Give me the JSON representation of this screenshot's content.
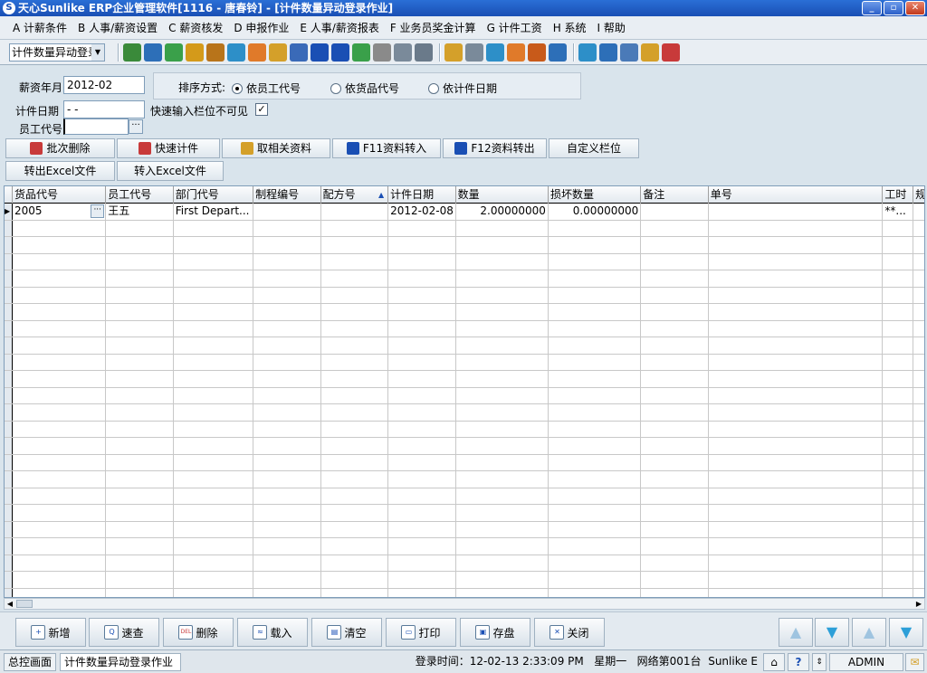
{
  "window": {
    "title": "天心Sunlike ERP企业管理软件[1116 - 唐春铃] - [计件数量异动登录作业]",
    "buttons": [
      "_",
      "▫",
      "✕"
    ]
  },
  "menu": [
    "A 计薪条件",
    "B 人事/薪资设置",
    "C 薪资核发",
    "D 申报作业",
    "E 人事/薪资报表",
    "F 业务员奖金计算",
    "G 计件工资",
    "H 系统",
    "I 帮助"
  ],
  "toolbar": {
    "select_value": "计件数量异动登录",
    "icons": [
      {
        "name": "tree-icon",
        "color": "#3a8a3a"
      },
      {
        "name": "monitor-icon",
        "color": "#2d6fb8"
      },
      {
        "name": "phone-icon",
        "color": "#3aa04a"
      },
      {
        "name": "coins-icon",
        "color": "#d49a1a"
      },
      {
        "name": "briefcase-icon",
        "color": "#b8741a"
      },
      {
        "name": "home-icon",
        "color": "#2d8fc8"
      },
      {
        "name": "people-icon",
        "color": "#e07a2a"
      },
      {
        "name": "mail-icon",
        "color": "#d4a02a"
      },
      {
        "name": "book-icon",
        "color": "#3a6ab8"
      },
      {
        "name": "key-icon",
        "color": "#1a4fb4"
      },
      {
        "name": "help-icon",
        "color": "#1a4fb4"
      },
      {
        "name": "dollar-icon",
        "color": "#3aa04a"
      },
      {
        "name": "cart-icon",
        "color": "#8a8a8a"
      },
      {
        "name": "document-icon",
        "color": "#7a8a9a"
      },
      {
        "name": "calculator-icon",
        "color": "#6a7a8a"
      },
      {
        "name": "folder-icon",
        "color": "#d4a02a"
      },
      {
        "name": "copy-icon",
        "color": "#7a8a9a"
      },
      {
        "name": "check-icon",
        "color": "#2d8fc8"
      },
      {
        "name": "bell-icon",
        "color": "#e07a2a"
      },
      {
        "name": "network-icon",
        "color": "#c85a1a"
      },
      {
        "name": "screen-icon",
        "color": "#2d6fb8"
      },
      {
        "name": "refresh-icon",
        "color": "#2d8fc8"
      },
      {
        "name": "window-icon",
        "color": "#2d6fb8"
      },
      {
        "name": "close-window-icon",
        "color": "#4a7ab8"
      },
      {
        "name": "tile-windows-icon",
        "color": "#d4a02a"
      },
      {
        "name": "exit-icon",
        "color": "#c83a3a"
      }
    ]
  },
  "form": {
    "salary_month_label": "薪资年月",
    "salary_month_value": "2012-02",
    "sort_label": "排序方式:",
    "sort_options": [
      "依员工代号",
      "依货品代号",
      "依计件日期"
    ],
    "sort_selected": 0,
    "piece_date_label": "计件日期",
    "piece_date_value": " -  -",
    "quick_input_label": "快速输入栏位不可见",
    "quick_input_checked": "✓",
    "employee_label": "员工代号",
    "employee_value": "",
    "ellipsis": "···"
  },
  "action_buttons": [
    {
      "label": "批次删除",
      "icon": "batch-delete-icon",
      "color": "#c83a3a"
    },
    {
      "label": "快速计件",
      "icon": "quick-count-icon",
      "color": "#c83a3a"
    },
    {
      "label": "取相关资料",
      "icon": "fetch-data-icon",
      "color": "#d4a02a"
    },
    {
      "label": "F11资料转入",
      "icon": "import-data-icon",
      "color": "#1a4fb4"
    },
    {
      "label": "F12资料转出",
      "icon": "export-data-icon",
      "color": "#1a4fb4"
    },
    {
      "label": "自定义栏位",
      "icon": "",
      "color": ""
    },
    {
      "label": "转出Excel文件",
      "icon": "",
      "color": ""
    },
    {
      "label": "转入Excel文件",
      "icon": "",
      "color": ""
    }
  ],
  "grid": {
    "columns": [
      "货品代号",
      "员工代号",
      "部门代号",
      "制程编号",
      "配方号",
      "计件日期",
      "数量",
      "损坏数量",
      "备注",
      "单号",
      "工时",
      "规"
    ],
    "sorted_column": 4,
    "rows": [
      [
        "2005",
        "王五",
        "First Depart...",
        "",
        "",
        "2012-02-08",
        "2.00000000",
        "0.00000000",
        "",
        "",
        "**...",
        ""
      ]
    ],
    "empty_rows": 23
  },
  "bottom_buttons": [
    {
      "label": "新增",
      "icon": "add-icon",
      "glyph": "+"
    },
    {
      "label": "速查",
      "icon": "search-icon",
      "glyph": "Q"
    },
    {
      "label": "删除",
      "icon": "delete-icon",
      "glyph": "DEL"
    },
    {
      "label": "载入",
      "icon": "load-icon",
      "glyph": "≈"
    },
    {
      "label": "清空",
      "icon": "clear-icon",
      "glyph": "▤"
    },
    {
      "label": "打印",
      "icon": "print-icon",
      "glyph": "▭"
    },
    {
      "label": "存盘",
      "icon": "save-icon",
      "glyph": "▣"
    },
    {
      "label": "关闭",
      "icon": "close-icon",
      "glyph": "✕"
    }
  ],
  "nav_buttons": [
    {
      "name": "first-record-icon",
      "glyph": "▲",
      "color": "#9fc4e0"
    },
    {
      "name": "prev-record-icon",
      "glyph": "▼",
      "color": "#2d9fd8"
    },
    {
      "name": "next-record-icon",
      "glyph": "▲",
      "color": "#9fc4e0"
    },
    {
      "name": "last-record-icon",
      "glyph": "▼",
      "color": "#2d9fd8"
    }
  ],
  "status": {
    "tab1": "总控画面",
    "tab2": "计件数量异动登录作业",
    "login_time": "登录时间：12-02-13 2:33:09 PM",
    "weekday": "星期一",
    "network": "网络第001台",
    "product": "Sunlike E",
    "user": "ADMIN"
  }
}
